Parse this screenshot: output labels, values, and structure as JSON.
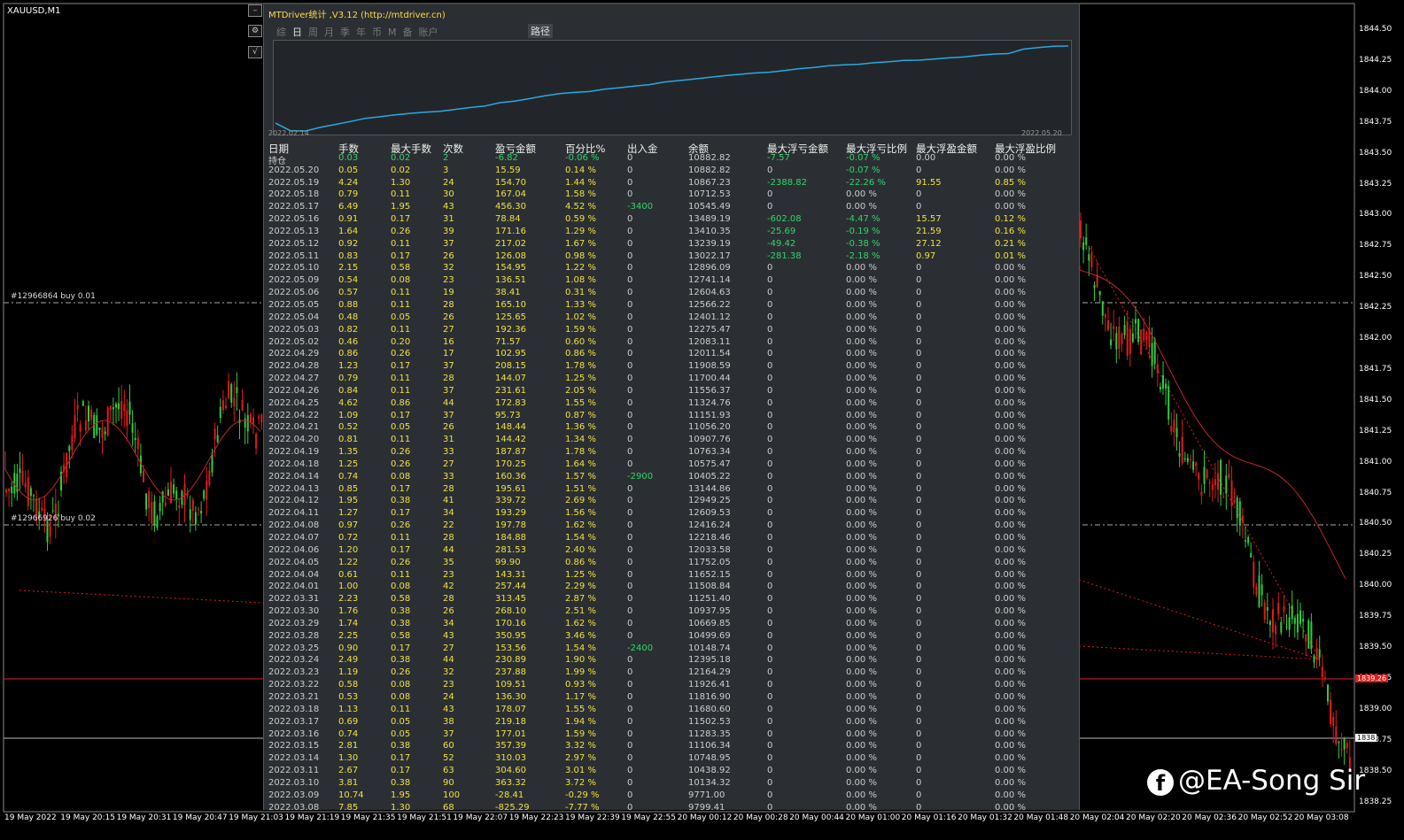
{
  "symbol_label": "XAUUSD,M1",
  "price_axis": [
    "1844.50",
    "1844.25",
    "1844.00",
    "1843.75",
    "1843.50",
    "1843.25",
    "1843.00",
    "1842.75",
    "1842.50",
    "1842.25",
    "1842.00",
    "1841.75",
    "1841.50",
    "1841.25",
    "1841.00",
    "1840.75",
    "1840.50",
    "1840.25",
    "1840.00",
    "1839.75",
    "1839.50",
    "1839.25",
    "1839.00",
    "1838.75",
    "1838.50",
    "1838.25"
  ],
  "time_axis": [
    "19 May 2022",
    "19 May 20:15",
    "19 May 20:31",
    "19 May 20:47",
    "19 May 21:03",
    "19 May 21:19",
    "19 May 21:35",
    "19 May 21:51",
    "19 May 22:07",
    "19 May 22:23",
    "19 May 22:39",
    "19 May 22:55",
    "20 May 00:12",
    "20 May 00:28",
    "20 May 00:44",
    "20 May 01:00",
    "20 May 01:16",
    "20 May 01:32",
    "20 May 01:48",
    "20 May 02:04",
    "20 May 02:20",
    "20 May 02:36",
    "20 May 02:52",
    "20 May 03:08"
  ],
  "order_labels": {
    "buy1": "#12966864 buy 0.01",
    "buy2": "#12966926 buy 0.02"
  },
  "price_tags": {
    "red": "1839.26",
    "white": "1838"
  },
  "toolbar_icons": [
    "minimize-icon",
    "settings-icon",
    "check-icon"
  ],
  "colors": {
    "bull": "#2ecc40",
    "bear": "#e01b1b",
    "ma": "#c0262f",
    "equity": "#29a9e0",
    "panel_bg": "#2b2f33",
    "green_text": "#2ed66a",
    "yellow_text": "#f0e040"
  },
  "panel": {
    "title": "MTDriver统计 ,V3.12 (http://mtdriver.cn)",
    "tabs": [
      "综",
      "日",
      "周",
      "月",
      "季",
      "年",
      "币",
      "M",
      "备",
      "账户"
    ],
    "active_tab": "日",
    "path_button": "路径",
    "equity_start_date": "2022.02.14",
    "equity_end_date": "2022.05.20",
    "headers": [
      "日期",
      "手数",
      "最大手数",
      "次数",
      "盈亏金额",
      "百分比%",
      "出入金",
      "余额",
      "最大浮亏金额",
      "最大浮亏比例",
      "最大浮盈金额",
      "最大浮盈比例"
    ],
    "rows": [
      [
        "持仓",
        "0.03",
        "0.02",
        "2",
        "-6.82",
        "-0.06 %",
        "0",
        "10882.82",
        "-7.57",
        "-0.07 %",
        "0.00",
        "0.00 %"
      ],
      [
        "2022.05.20",
        "0.05",
        "0.02",
        "3",
        "15.59",
        "0.14 %",
        "0",
        "10882.82",
        "0",
        "-0.07 %",
        "0",
        "0.00 %"
      ],
      [
        "2022.05.19",
        "4.24",
        "1.30",
        "24",
        "154.70",
        "1.44 %",
        "0",
        "10867.23",
        "-2388.82",
        "-22.26 %",
        "91.55",
        "0.85 %"
      ],
      [
        "2022.05.18",
        "0.79",
        "0.11",
        "30",
        "167.04",
        "1.58 %",
        "0",
        "10712.53",
        "0",
        "0.00 %",
        "0",
        "0.00 %"
      ],
      [
        "2022.05.17",
        "6.49",
        "1.95",
        "43",
        "456.30",
        "4.52 %",
        "-3400",
        "10545.49",
        "0",
        "0.00 %",
        "0",
        "0.00 %"
      ],
      [
        "2022.05.16",
        "0.91",
        "0.17",
        "31",
        "78.84",
        "0.59 %",
        "0",
        "13489.19",
        "-602.08",
        "-4.47 %",
        "15.57",
        "0.12 %"
      ],
      [
        "2022.05.13",
        "1.64",
        "0.26",
        "39",
        "171.16",
        "1.29 %",
        "0",
        "13410.35",
        "-25.69",
        "-0.19 %",
        "21.59",
        "0.16 %"
      ],
      [
        "2022.05.12",
        "0.92",
        "0.11",
        "37",
        "217.02",
        "1.67 %",
        "0",
        "13239.19",
        "-49.42",
        "-0.38 %",
        "27.12",
        "0.21 %"
      ],
      [
        "2022.05.11",
        "0.83",
        "0.17",
        "26",
        "126.08",
        "0.98 %",
        "0",
        "13022.17",
        "-281.38",
        "-2.18 %",
        "0.97",
        "0.01 %"
      ],
      [
        "2022.05.10",
        "2.15",
        "0.58",
        "32",
        "154.95",
        "1.22 %",
        "0",
        "12896.09",
        "0",
        "0.00 %",
        "0",
        "0.00 %"
      ],
      [
        "2022.05.09",
        "0.54",
        "0.08",
        "23",
        "136.51",
        "1.08 %",
        "0",
        "12741.14",
        "0",
        "0.00 %",
        "0",
        "0.00 %"
      ],
      [
        "2022.05.06",
        "0.57",
        "0.11",
        "19",
        "38.41",
        "0.31 %",
        "0",
        "12604.63",
        "0",
        "0.00 %",
        "0",
        "0.00 %"
      ],
      [
        "2022.05.05",
        "0.88",
        "0.11",
        "28",
        "165.10",
        "1.33 %",
        "0",
        "12566.22",
        "0",
        "0.00 %",
        "0",
        "0.00 %"
      ],
      [
        "2022.05.04",
        "0.48",
        "0.05",
        "26",
        "125.65",
        "1.02 %",
        "0",
        "12401.12",
        "0",
        "0.00 %",
        "0",
        "0.00 %"
      ],
      [
        "2022.05.03",
        "0.82",
        "0.11",
        "27",
        "192.36",
        "1.59 %",
        "0",
        "12275.47",
        "0",
        "0.00 %",
        "0",
        "0.00 %"
      ],
      [
        "2022.05.02",
        "0.46",
        "0.20",
        "16",
        "71.57",
        "0.60 %",
        "0",
        "12083.11",
        "0",
        "0.00 %",
        "0",
        "0.00 %"
      ],
      [
        "2022.04.29",
        "0.86",
        "0.26",
        "17",
        "102.95",
        "0.86 %",
        "0",
        "12011.54",
        "0",
        "0.00 %",
        "0",
        "0.00 %"
      ],
      [
        "2022.04.28",
        "1.23",
        "0.17",
        "37",
        "208.15",
        "1.78 %",
        "0",
        "11908.59",
        "0",
        "0.00 %",
        "0",
        "0.00 %"
      ],
      [
        "2022.04.27",
        "0.79",
        "0.11",
        "28",
        "144.07",
        "1.25 %",
        "0",
        "11700.44",
        "0",
        "0.00 %",
        "0",
        "0.00 %"
      ],
      [
        "2022.04.26",
        "0.84",
        "0.11",
        "37",
        "231.61",
        "2.05 %",
        "0",
        "11556.37",
        "0",
        "0.00 %",
        "0",
        "0.00 %"
      ],
      [
        "2022.04.25",
        "4.62",
        "0.86",
        "44",
        "172.83",
        "1.55 %",
        "0",
        "11324.76",
        "0",
        "0.00 %",
        "0",
        "0.00 %"
      ],
      [
        "2022.04.22",
        "1.09",
        "0.17",
        "37",
        "95.73",
        "0.87 %",
        "0",
        "11151.93",
        "0",
        "0.00 %",
        "0",
        "0.00 %"
      ],
      [
        "2022.04.21",
        "0.52",
        "0.05",
        "26",
        "148.44",
        "1.36 %",
        "0",
        "11056.20",
        "0",
        "0.00 %",
        "0",
        "0.00 %"
      ],
      [
        "2022.04.20",
        "0.81",
        "0.11",
        "31",
        "144.42",
        "1.34 %",
        "0",
        "10907.76",
        "0",
        "0.00 %",
        "0",
        "0.00 %"
      ],
      [
        "2022.04.19",
        "1.35",
        "0.26",
        "33",
        "187.87",
        "1.78 %",
        "0",
        "10763.34",
        "0",
        "0.00 %",
        "0",
        "0.00 %"
      ],
      [
        "2022.04.18",
        "1.25",
        "0.26",
        "27",
        "170.25",
        "1.64 %",
        "0",
        "10575.47",
        "0",
        "0.00 %",
        "0",
        "0.00 %"
      ],
      [
        "2022.04.14",
        "0.74",
        "0.08",
        "33",
        "160.36",
        "1.57 %",
        "-2900",
        "10405.22",
        "0",
        "0.00 %",
        "0",
        "0.00 %"
      ],
      [
        "2022.04.13",
        "0.85",
        "0.17",
        "28",
        "195.61",
        "1.51 %",
        "0",
        "13144.86",
        "0",
        "0.00 %",
        "0",
        "0.00 %"
      ],
      [
        "2022.04.12",
        "1.95",
        "0.38",
        "41",
        "339.72",
        "2.69 %",
        "0",
        "12949.25",
        "0",
        "0.00 %",
        "0",
        "0.00 %"
      ],
      [
        "2022.04.11",
        "1.27",
        "0.17",
        "34",
        "193.29",
        "1.56 %",
        "0",
        "12609.53",
        "0",
        "0.00 %",
        "0",
        "0.00 %"
      ],
      [
        "2022.04.08",
        "0.97",
        "0.26",
        "22",
        "197.78",
        "1.62 %",
        "0",
        "12416.24",
        "0",
        "0.00 %",
        "0",
        "0.00 %"
      ],
      [
        "2022.04.07",
        "0.72",
        "0.11",
        "28",
        "184.88",
        "1.54 %",
        "0",
        "12218.46",
        "0",
        "0.00 %",
        "0",
        "0.00 %"
      ],
      [
        "2022.04.06",
        "1.20",
        "0.17",
        "44",
        "281.53",
        "2.40 %",
        "0",
        "12033.58",
        "0",
        "0.00 %",
        "0",
        "0.00 %"
      ],
      [
        "2022.04.05",
        "1.22",
        "0.26",
        "35",
        "99.90",
        "0.86 %",
        "0",
        "11752.05",
        "0",
        "0.00 %",
        "0",
        "0.00 %"
      ],
      [
        "2022.04.04",
        "0.61",
        "0.11",
        "23",
        "143.31",
        "1.25 %",
        "0",
        "11652.15",
        "0",
        "0.00 %",
        "0",
        "0.00 %"
      ],
      [
        "2022.04.01",
        "1.00",
        "0.08",
        "42",
        "257.44",
        "2.29 %",
        "0",
        "11508.84",
        "0",
        "0.00 %",
        "0",
        "0.00 %"
      ],
      [
        "2022.03.31",
        "2.23",
        "0.58",
        "28",
        "313.45",
        "2.87 %",
        "0",
        "11251.40",
        "0",
        "0.00 %",
        "0",
        "0.00 %"
      ],
      [
        "2022.03.30",
        "1.76",
        "0.38",
        "26",
        "268.10",
        "2.51 %",
        "0",
        "10937.95",
        "0",
        "0.00 %",
        "0",
        "0.00 %"
      ],
      [
        "2022.03.29",
        "1.74",
        "0.38",
        "34",
        "170.16",
        "1.62 %",
        "0",
        "10669.85",
        "0",
        "0.00 %",
        "0",
        "0.00 %"
      ],
      [
        "2022.03.28",
        "2.25",
        "0.58",
        "43",
        "350.95",
        "3.46 %",
        "0",
        "10499.69",
        "0",
        "0.00 %",
        "0",
        "0.00 %"
      ],
      [
        "2022.03.25",
        "0.90",
        "0.17",
        "27",
        "153.56",
        "1.54 %",
        "-2400",
        "10148.74",
        "0",
        "0.00 %",
        "0",
        "0.00 %"
      ],
      [
        "2022.03.24",
        "2.49",
        "0.38",
        "44",
        "230.89",
        "1.90 %",
        "0",
        "12395.18",
        "0",
        "0.00 %",
        "0",
        "0.00 %"
      ],
      [
        "2022.03.23",
        "1.19",
        "0.26",
        "32",
        "237.88",
        "1.99 %",
        "0",
        "12164.29",
        "0",
        "0.00 %",
        "0",
        "0.00 %"
      ],
      [
        "2022.03.22",
        "0.58",
        "0.08",
        "23",
        "109.51",
        "0.93 %",
        "0",
        "11926.41",
        "0",
        "0.00 %",
        "0",
        "0.00 %"
      ],
      [
        "2022.03.21",
        "0.53",
        "0.08",
        "24",
        "136.30",
        "1.17 %",
        "0",
        "11816.90",
        "0",
        "0.00 %",
        "0",
        "0.00 %"
      ],
      [
        "2022.03.18",
        "1.13",
        "0.11",
        "43",
        "178.07",
        "1.55 %",
        "0",
        "11680.60",
        "0",
        "0.00 %",
        "0",
        "0.00 %"
      ],
      [
        "2022.03.17",
        "0.69",
        "0.05",
        "38",
        "219.18",
        "1.94 %",
        "0",
        "11502.53",
        "0",
        "0.00 %",
        "0",
        "0.00 %"
      ],
      [
        "2022.03.16",
        "0.74",
        "0.05",
        "37",
        "177.01",
        "1.59 %",
        "0",
        "11283.35",
        "0",
        "0.00 %",
        "0",
        "0.00 %"
      ],
      [
        "2022.03.15",
        "2.81",
        "0.38",
        "60",
        "357.39",
        "3.32 %",
        "0",
        "11106.34",
        "0",
        "0.00 %",
        "0",
        "0.00 %"
      ],
      [
        "2022.03.14",
        "1.30",
        "0.17",
        "52",
        "310.03",
        "2.97 %",
        "0",
        "10748.95",
        "0",
        "0.00 %",
        "0",
        "0.00 %"
      ],
      [
        "2022.03.11",
        "2.67",
        "0.17",
        "63",
        "304.60",
        "3.01 %",
        "0",
        "10438.92",
        "0",
        "0.00 %",
        "0",
        "0.00 %"
      ],
      [
        "2022.03.10",
        "3.81",
        "0.38",
        "90",
        "363.32",
        "3.72 %",
        "0",
        "10134.32",
        "0",
        "0.00 %",
        "0",
        "0.00 %"
      ],
      [
        "2022.03.09",
        "10.74",
        "1.95",
        "100",
        "-28.41",
        "-0.29 %",
        "0",
        "9771.00",
        "0",
        "0.00 %",
        "0",
        "0.00 %"
      ],
      [
        "2022.03.08",
        "7.85",
        "1.30",
        "68",
        "-825.29",
        "-7.77 %",
        "0",
        "9799.41",
        "0",
        "0.00 %",
        "0",
        "0.00 %"
      ]
    ]
  },
  "watermark": "@EA-Song Sir"
}
